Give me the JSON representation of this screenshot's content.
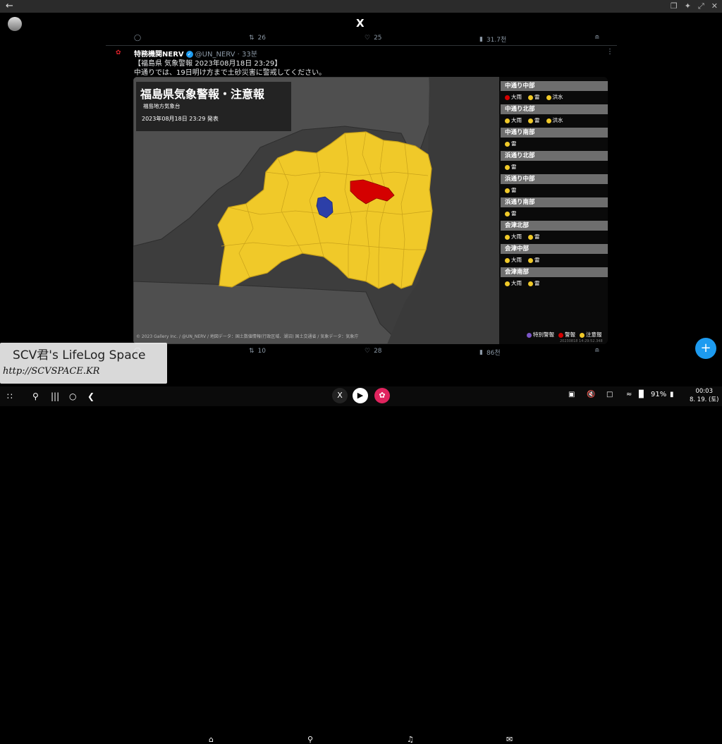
{
  "window": {
    "back_icon": "arrow-left-icon",
    "right_icons": [
      "multiwindow-icon",
      "pin-icon",
      "resize-icon",
      "close-icon"
    ]
  },
  "app": {
    "logo": "X"
  },
  "actions_top": {
    "reply": "",
    "retweet": "26",
    "like": "25",
    "views": "31.7천"
  },
  "tweet": {
    "author": "特務機関NERV",
    "handle": "@UN_NERV",
    "time": "33분",
    "line1": "【福島県 気象警報 2023年08月18日 23:29】",
    "line2": "中通りでは、19日明け方まで土砂災害に警戒してください。"
  },
  "map": {
    "title": "福島県気象警報・注意報",
    "office": "福島地方気象台",
    "issued": "2023年08月18日 23:29 発表",
    "credits": "© 2023 Gallery Inc. / @UN_NERV / 地図データ：国土数値情報(行政区域、湖沼) 国土交通省 / 気象データ：気象庁",
    "stamp": "20230818 14:29:52.348",
    "colors": {
      "warning": "#d40000",
      "advisory": "#f0c929",
      "special": "#2c3fa8",
      "land": "#4f4f4f",
      "sea": "#3a3a3a"
    }
  },
  "regions": [
    {
      "name": "中通り中部",
      "items": [
        {
          "label": "大雨",
          "level": "warning"
        },
        {
          "label": "雷",
          "level": "advisory"
        },
        {
          "label": "洪水",
          "level": "advisory"
        }
      ]
    },
    {
      "name": "中通り北部",
      "items": [
        {
          "label": "大雨",
          "level": "advisory"
        },
        {
          "label": "雷",
          "level": "advisory"
        },
        {
          "label": "洪水",
          "level": "advisory"
        }
      ]
    },
    {
      "name": "中通り南部",
      "items": [
        {
          "label": "雷",
          "level": "advisory"
        }
      ]
    },
    {
      "name": "浜通り北部",
      "items": [
        {
          "label": "雷",
          "level": "advisory"
        }
      ]
    },
    {
      "name": "浜通り中部",
      "items": [
        {
          "label": "雷",
          "level": "advisory"
        }
      ]
    },
    {
      "name": "浜通り南部",
      "items": [
        {
          "label": "雷",
          "level": "advisory"
        }
      ]
    },
    {
      "name": "会津北部",
      "items": [
        {
          "label": "大雨",
          "level": "advisory"
        },
        {
          "label": "雷",
          "level": "advisory"
        }
      ]
    },
    {
      "name": "会津中部",
      "items": [
        {
          "label": "大雨",
          "level": "advisory"
        },
        {
          "label": "雷",
          "level": "advisory"
        }
      ]
    },
    {
      "name": "会津南部",
      "items": [
        {
          "label": "大雨",
          "level": "advisory"
        },
        {
          "label": "雷",
          "level": "advisory"
        }
      ]
    }
  ],
  "legend": {
    "special": "特別警報",
    "warning": "警報",
    "advisory": "注意報"
  },
  "actions_bottom": {
    "reply": "",
    "retweet": "10",
    "like": "28",
    "views": "86천"
  },
  "watermark": {
    "line1": "SCV君's LifeLog Space",
    "line2": "http://SCVSPACE.KR"
  },
  "bottom_nav": [
    "home-icon",
    "search-icon",
    "notifications-icon",
    "messages-icon"
  ],
  "status": {
    "battery": "91%",
    "time": "00:03",
    "date": "8. 19. (토)"
  }
}
